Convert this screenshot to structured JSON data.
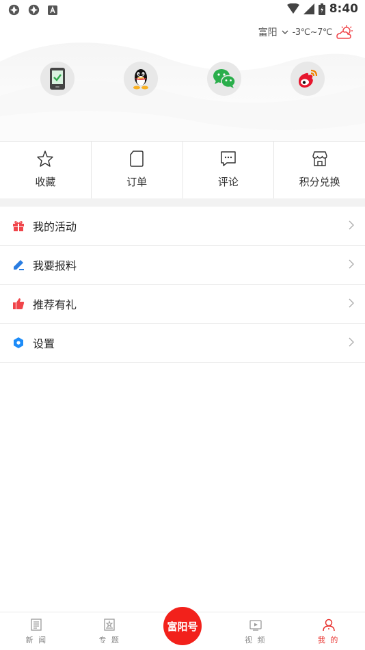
{
  "status_bar": {
    "time": "8:40"
  },
  "weather": {
    "city": "富阳",
    "temp": "-3℃~7℃"
  },
  "login": {
    "items": [
      {
        "name": "phone-login-icon"
      },
      {
        "name": "qq-login-icon"
      },
      {
        "name": "wechat-login-icon"
      },
      {
        "name": "weibo-login-icon"
      }
    ]
  },
  "quick": {
    "items": [
      {
        "label": "收藏",
        "icon": "star-icon"
      },
      {
        "label": "订单",
        "icon": "document-icon"
      },
      {
        "label": "评论",
        "icon": "comment-icon"
      },
      {
        "label": "积分兑换",
        "icon": "store-icon"
      }
    ]
  },
  "menu": {
    "items": [
      {
        "label": "我的活动",
        "icon": "gift-icon",
        "color": "#f0454a"
      },
      {
        "label": "我要报料",
        "icon": "pen-icon",
        "color": "#2a7de1"
      },
      {
        "label": "推荐有礼",
        "icon": "thumbs-up-icon",
        "color": "#f0454a"
      },
      {
        "label": "设置",
        "icon": "settings-hexagon-icon",
        "color": "#1d8cf8"
      }
    ]
  },
  "tabs": {
    "items": [
      {
        "label": "新 闻",
        "icon": "newspaper-icon"
      },
      {
        "label": "专 题",
        "icon": "topic-icon"
      },
      {
        "label": "富阳号",
        "icon": "center-icon"
      },
      {
        "label": "视 频",
        "icon": "video-icon"
      },
      {
        "label": "我 的",
        "icon": "user-icon"
      }
    ],
    "active_index": 4,
    "accent": "#f2211b"
  }
}
